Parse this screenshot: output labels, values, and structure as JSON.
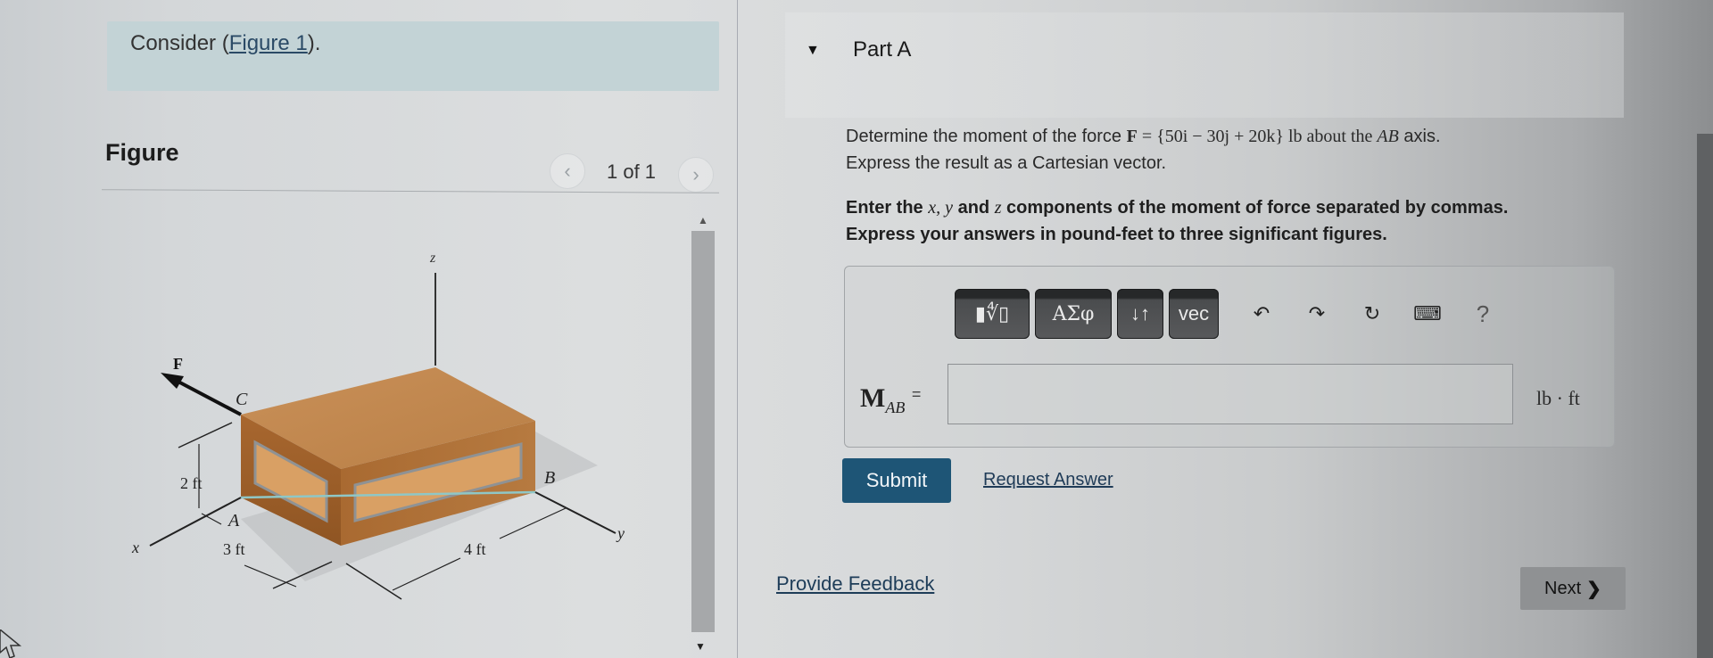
{
  "problem": {
    "consider_prefix": "Consider (",
    "consider_link": "Figure 1",
    "consider_suffix": ")."
  },
  "figure": {
    "heading": "Figure",
    "counter": "1 of 1",
    "prev_icon": "chevron-left-icon",
    "next_icon": "chevron-right-icon",
    "labels": {
      "z": "z",
      "x": "x",
      "y": "y",
      "force": "F",
      "point_a": "A",
      "point_b": "B",
      "point_c": "C",
      "dim_height": "2 ft",
      "dim_width": "3 ft",
      "dim_length": "4 ft"
    },
    "colors": {
      "wood_top": "#c28a52",
      "wood_side": "#a9672e",
      "wood_inset": "#d29a5e",
      "axis_line": "#3a8a94"
    }
  },
  "scrollbar": {
    "up_icon": "▲",
    "down_icon": "▼"
  },
  "part": {
    "caret": "▼",
    "title": "Part A"
  },
  "question": {
    "line1_pre": "Determine the moment of the force ",
    "force_symbol": "F",
    "equals": " = ",
    "force_vector": "{50i − 30j + 20k}",
    "line1_unit": " lb about the ",
    "axis_name": "AB",
    "line1_post": " axis.",
    "line2": "Express the result as a Cartesian vector.",
    "instr1_pre": "Enter the ",
    "instr1_vars": "x, y",
    "instr1_and": " and ",
    "instr1_z": "z",
    "instr1_post": " components of the moment of force separated  by commas.",
    "instr2": "Express your answers in pound-feet to three significant figures."
  },
  "toolbar": {
    "template_btn": "▮∜▯",
    "greek_btn": "ΑΣφ",
    "subsup_btn": "↓↑",
    "vec_btn": "vec",
    "undo": "↶",
    "redo": "↷",
    "reset": "↻",
    "keyboard": "⌨",
    "help": "?"
  },
  "answer": {
    "label_main": "M",
    "label_sub": "AB",
    "label_eq": "=",
    "value": "",
    "placeholder": "",
    "unit": "lb · ft"
  },
  "actions": {
    "submit": "Submit",
    "request_answer": "Request Answer",
    "provide_feedback": "Provide Feedback",
    "next": "Next",
    "next_icon": "❯"
  },
  "colors": {
    "submit_bg": "#1e5576",
    "link": "#1f3b57",
    "consider_bg": "#c3d3d6"
  }
}
